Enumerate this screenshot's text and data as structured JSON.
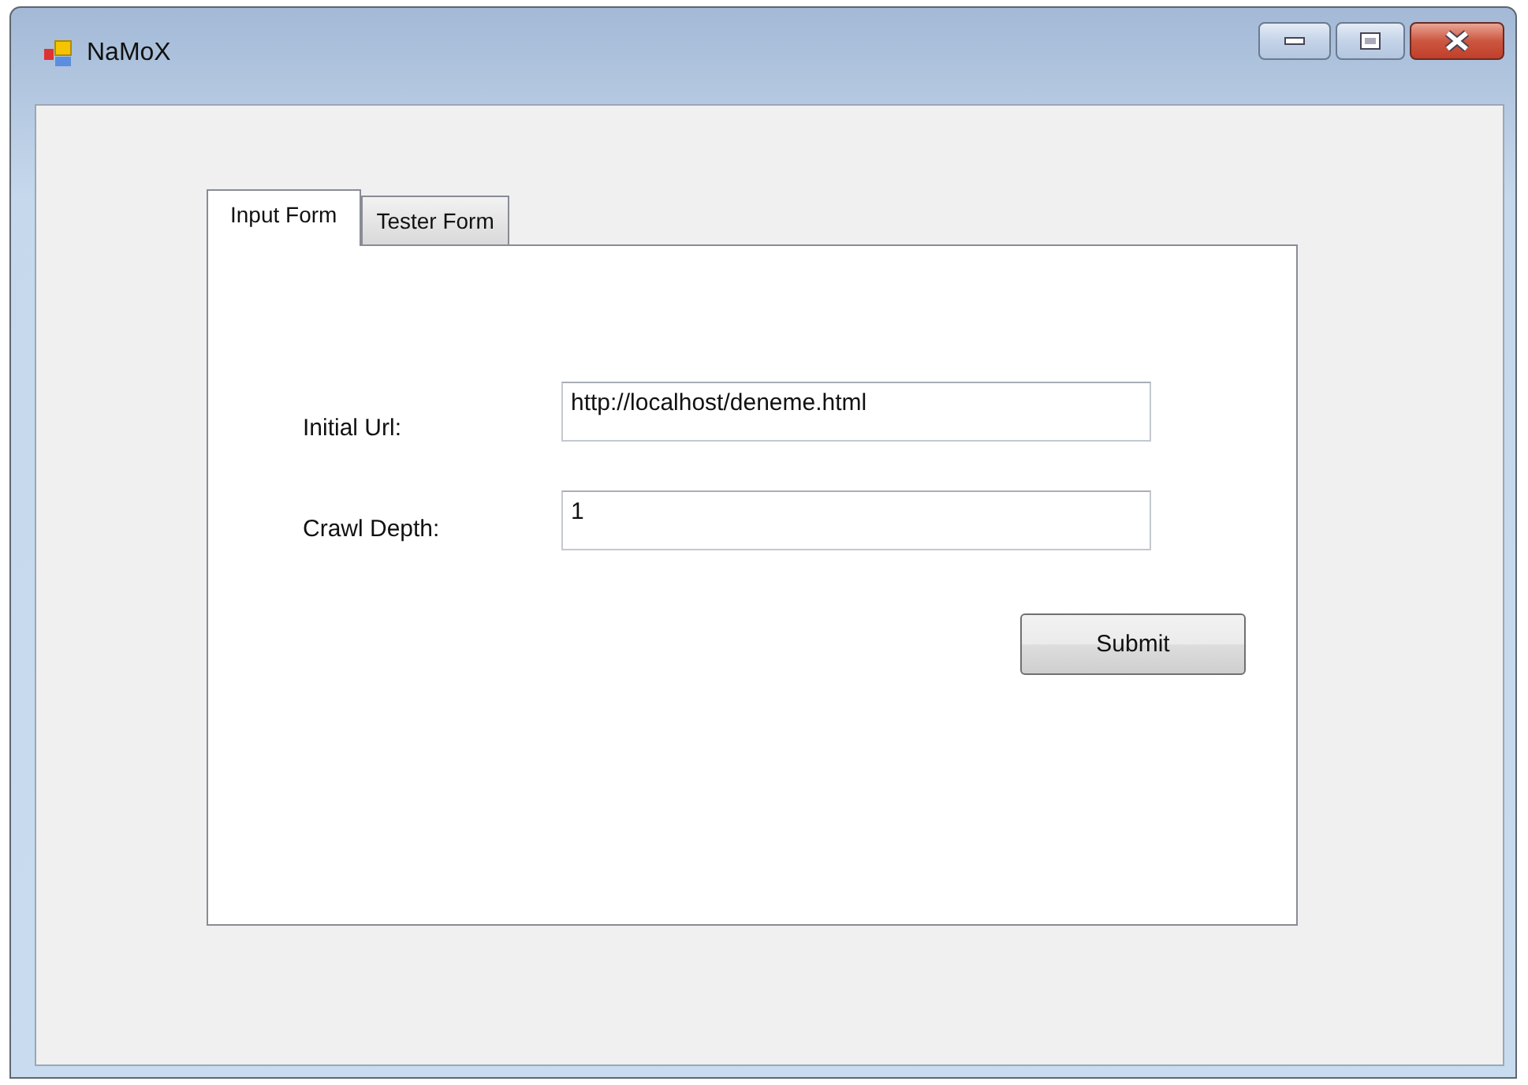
{
  "window": {
    "title": "NaMoX"
  },
  "tabs": [
    {
      "label": "Input Form",
      "selected": true
    },
    {
      "label": "Tester Form",
      "selected": false
    }
  ],
  "fields": [
    {
      "label": "Initial Url:",
      "value": "http://localhost/deneme.html"
    },
    {
      "label": "Crawl Depth:",
      "value": "1"
    }
  ],
  "submit_button": {
    "label": "Submit"
  }
}
